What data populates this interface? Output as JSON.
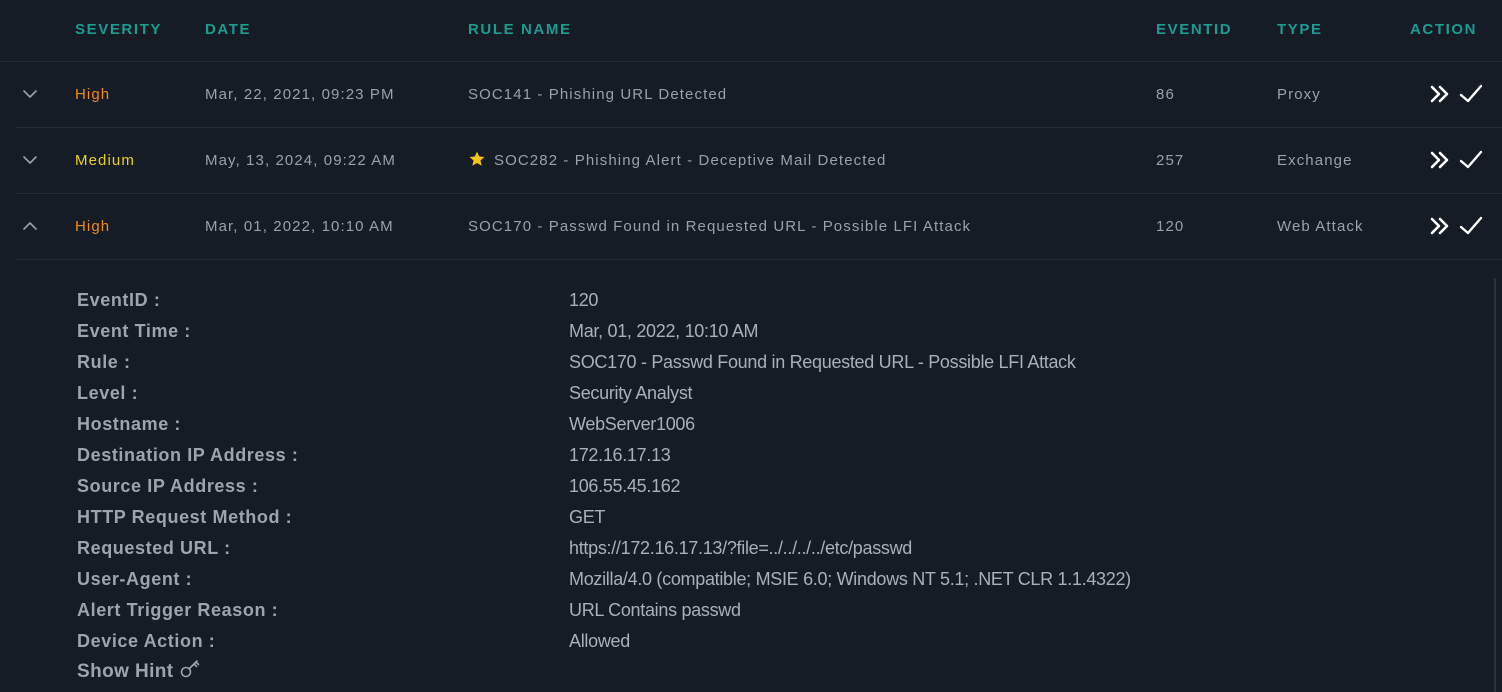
{
  "header": {
    "severity": "SEVERITY",
    "date": "DATE",
    "rule_name": "RULE NAME",
    "eventid": "EVENTID",
    "type": "TYPE",
    "action": "ACTION"
  },
  "rows": [
    {
      "expanded": false,
      "severity": "High",
      "date": "Mar, 22, 2021, 09:23 PM",
      "rule": "SOC141 - Phishing URL Detected",
      "starred": false,
      "eventid": "86",
      "type": "Proxy"
    },
    {
      "expanded": false,
      "severity": "Medium",
      "date": "May, 13, 2024, 09:22 AM",
      "rule": "SOC282 - Phishing Alert - Deceptive Mail Detected",
      "starred": true,
      "eventid": "257",
      "type": "Exchange"
    },
    {
      "expanded": true,
      "severity": "High",
      "date": "Mar, 01, 2022, 10:10 AM",
      "rule": "SOC170 - Passwd Found in Requested URL - Possible LFI Attack",
      "starred": false,
      "eventid": "120",
      "type": "Web Attack"
    }
  ],
  "details": [
    {
      "label": "EventID :",
      "value": "120"
    },
    {
      "label": "Event Time :",
      "value": "Mar, 01, 2022, 10:10 AM"
    },
    {
      "label": "Rule :",
      "value": "SOC170 - Passwd Found in Requested URL - Possible LFI Attack"
    },
    {
      "label": "Level :",
      "value": "Security Analyst"
    },
    {
      "label": "Hostname :",
      "value": "WebServer1006"
    },
    {
      "label": "Destination IP Address :",
      "value": "172.16.17.13"
    },
    {
      "label": "Source IP Address :",
      "value": "106.55.45.162"
    },
    {
      "label": "HTTP Request Method :",
      "value": "GET"
    },
    {
      "label": "Requested URL :",
      "value": "https://172.16.17.13/?file=../../../../etc/passwd"
    },
    {
      "label": "User-Agent :",
      "value": "Mozilla/4.0 (compatible; MSIE 6.0; Windows NT 5.1; .NET CLR 1.1.4322)"
    },
    {
      "label": "Alert Trigger Reason :",
      "value": "URL Contains passwd"
    },
    {
      "label": "Device Action :",
      "value": "Allowed"
    }
  ],
  "hint": {
    "label": "Show Hint",
    "icon": "key-icon"
  },
  "colors": {
    "background": "#161c26",
    "header_accent": "#1e9b8f",
    "severity_high": "#f08a1e",
    "severity_medium": "#e8d22a",
    "star": "#f5c518"
  },
  "icons": {
    "expand": "chevron-down-icon",
    "collapse": "chevron-up-icon",
    "escalate": "double-chevron-right-icon",
    "close_alert": "checkmark-icon",
    "starred": "star-icon"
  }
}
